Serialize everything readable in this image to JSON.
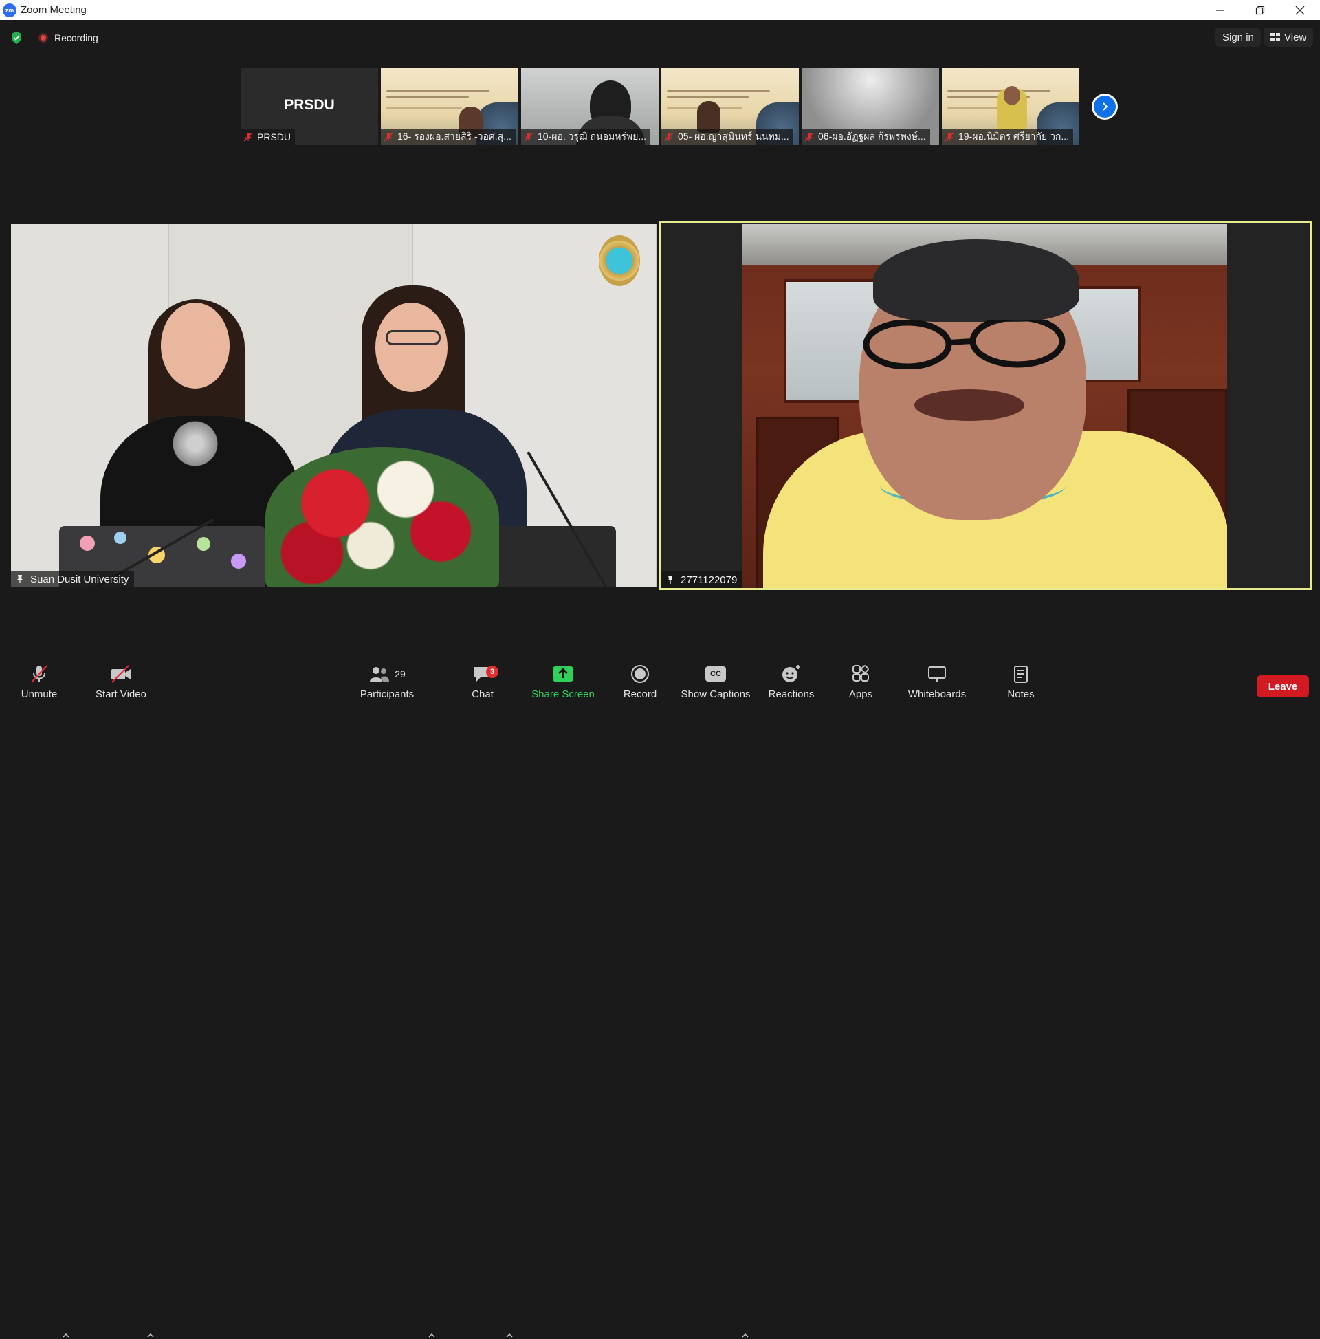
{
  "window": {
    "app_logo": "zm",
    "title": "Zoom Meeting",
    "controls": [
      "minimize-icon",
      "restore-icon",
      "close-icon"
    ]
  },
  "topbar": {
    "recording_label": "Recording",
    "sign_in_label": "Sign in",
    "view_label": "View"
  },
  "thumbnails": [
    {
      "name": "PRSDU",
      "logo": "PRSDU",
      "kind": "logo"
    },
    {
      "name": "16- รองผอ.สายสิริ -วอศ.สุ...",
      "kind": "slide"
    },
    {
      "name": "10-ผอ. วรุฒิ ถนอมหร่พย...",
      "kind": "camera"
    },
    {
      "name": "05- ผอ.ญาสุมินทร์ นนทม...",
      "kind": "slide"
    },
    {
      "name": "06-ผอ.อัฏฐผล ก้รพรพงษ์...",
      "kind": "blank"
    },
    {
      "name": "19-ผอ.นิมิตร ศรียากัย วก...",
      "kind": "slide"
    }
  ],
  "main_tiles": {
    "left_name": "Suan Dusit University",
    "right_name": "2771122079"
  },
  "toolbar": {
    "unmute_label": "Unmute",
    "start_video_label": "Start Video",
    "participants_label": "Participants",
    "participants_count": "29",
    "chat_label": "Chat",
    "chat_badge": "3",
    "share_screen_label": "Share Screen",
    "record_label": "Record",
    "captions_label": "Show Captions",
    "captions_icon_text": "CC",
    "reactions_label": "Reactions",
    "apps_label": "Apps",
    "whiteboards_label": "Whiteboards",
    "notes_label": "Notes",
    "leave_label": "Leave"
  },
  "colors": {
    "active_speaker_border": "#e8ea8f",
    "share_green": "#2fd15b",
    "leave_red": "#d11a22",
    "recording_red": "#e2443b"
  }
}
